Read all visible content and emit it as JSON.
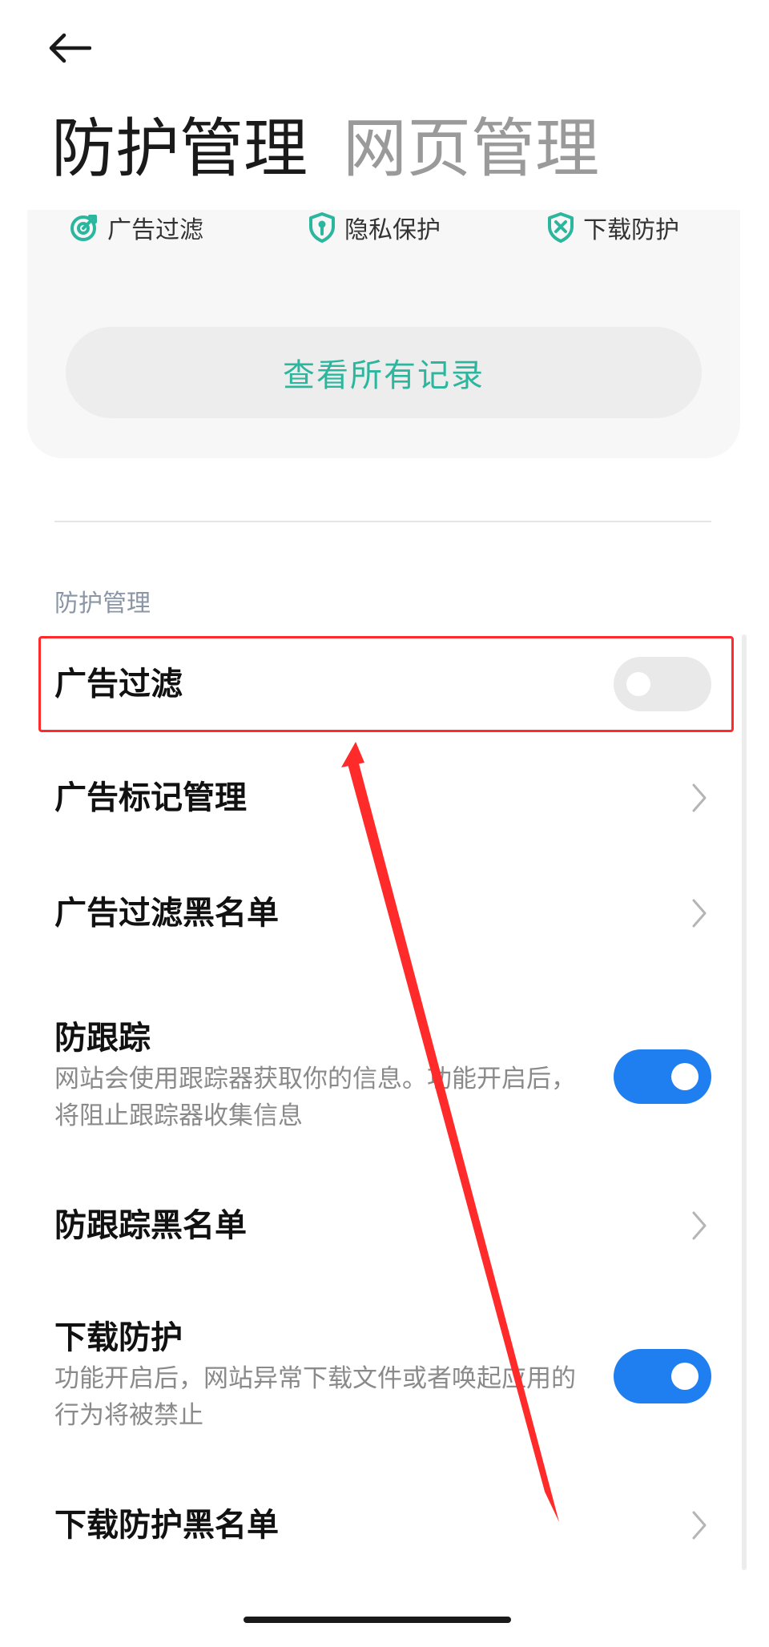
{
  "header": {
    "back_icon": "arrow-left-icon",
    "tabs": [
      {
        "label": "防护管理",
        "active": true
      },
      {
        "label": "网页管理",
        "active": false
      }
    ]
  },
  "summary": {
    "stats": [
      {
        "icon": "ad-filter-target-icon",
        "label": "广告过滤"
      },
      {
        "icon": "privacy-shield-icon",
        "label": "隐私保护"
      },
      {
        "icon": "download-shield-icon",
        "label": "下载防护"
      }
    ],
    "view_all_label": "查看所有记录",
    "accent_color": "#2bb69d"
  },
  "section": {
    "label": "防护管理"
  },
  "settings": [
    {
      "title": "广告过滤",
      "type": "toggle",
      "enabled": false
    },
    {
      "title": "广告标记管理",
      "type": "link"
    },
    {
      "title": "广告过滤黑名单",
      "type": "link"
    },
    {
      "title": "防跟踪",
      "description": "网站会使用跟踪器获取你的信息。功能开启后，将阻止跟踪器收集信息",
      "type": "toggle",
      "enabled": true
    },
    {
      "title": "防跟踪黑名单",
      "type": "link"
    },
    {
      "title": "下载防护",
      "description": "功能开启后，网站异常下载文件或者唤起应用的行为将被禁止",
      "type": "toggle",
      "enabled": true
    },
    {
      "title": "下载防护黑名单",
      "type": "link"
    }
  ],
  "colors": {
    "toggle_on": "#1f7ef0",
    "toggle_off": "#e9e9e9",
    "annotation": "#ff2a2a"
  }
}
